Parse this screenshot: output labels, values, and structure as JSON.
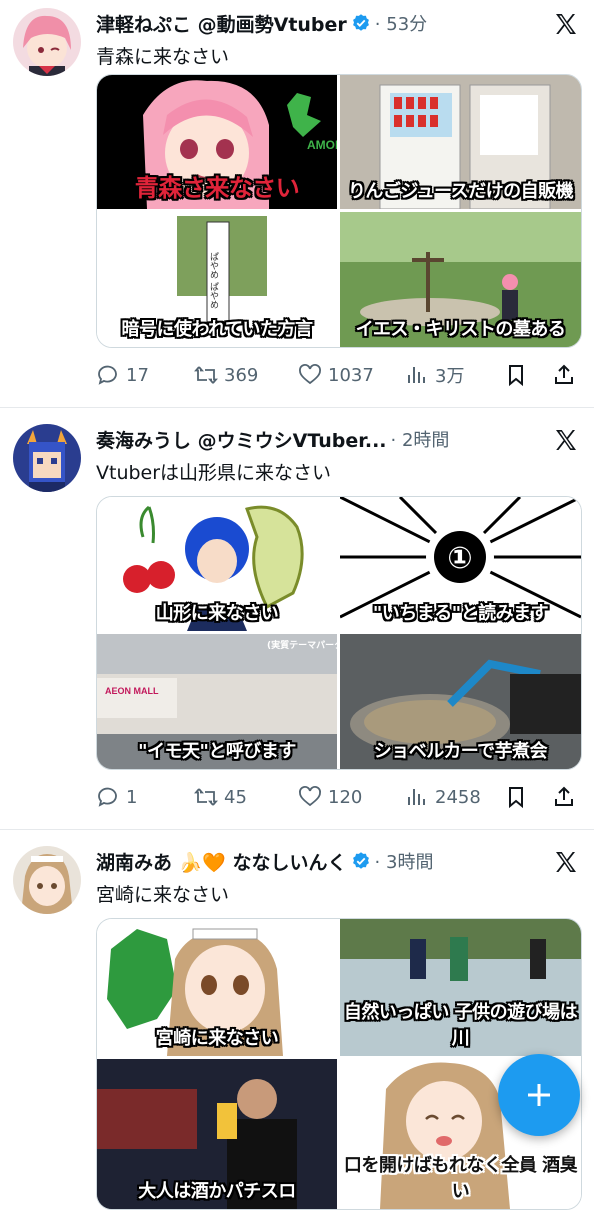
{
  "tweets": [
    {
      "name": "津軽ねぷこ @動画勢Vtuber",
      "meta": "· 53分",
      "text": "青森に来なさい",
      "captions": [
        "青森さ来なさい",
        "りんごジュースだけの自販機",
        "暗号に使われていた方言",
        "イエス・キリストの墓ある"
      ],
      "replies": "17",
      "reposts": "369",
      "likes": "1037",
      "views": "3万"
    },
    {
      "name": "奏海みうし @ウミウシVTuber...",
      "meta": "· 2時間",
      "text": "Vtuberは山形県に来なさい",
      "captions": [
        "山形に来なさい",
        "\"いちまる\"と読みます",
        "\"イモ天\"と呼びます",
        "ショベルカーで芋煮会"
      ],
      "replies": "1",
      "reposts": "45",
      "likes": "120",
      "views": "2458"
    },
    {
      "name": "湖南みあ 🍌🧡 ななしいんく",
      "meta": "· 3時間",
      "text": "宮崎に来なさい",
      "captions": [
        "宮崎に来なさい",
        "自然いっぱい 子供の遊び場は川",
        "大人は酒かパチスロ",
        "口を開けばもれなく全員 酒臭い"
      ]
    }
  ],
  "extras": {
    "t1_sign": "ぱやめ ぱやめ",
    "t2_num": "①",
    "t2_tag": "(実質テーマパーク)",
    "t2_mall": "AEON MALL"
  }
}
